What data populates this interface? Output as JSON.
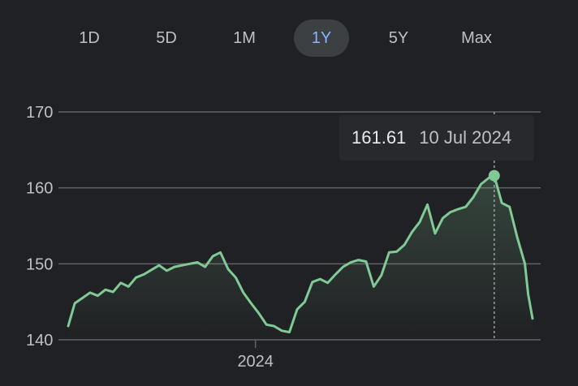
{
  "range_tabs": {
    "items": [
      {
        "label": "1D"
      },
      {
        "label": "5D"
      },
      {
        "label": "1M"
      },
      {
        "label": "1Y"
      },
      {
        "label": "5Y"
      },
      {
        "label": "Max"
      }
    ],
    "active": "1Y"
  },
  "tooltip": {
    "value": "161.61",
    "date": "10 Jul 2024"
  },
  "colors": {
    "background": "#202124",
    "line": "#81c995",
    "grid": "#5f6368",
    "tab_active_bg": "#3c4043",
    "tab_active_text": "#8ab4f8",
    "text": "#bdc1c6"
  },
  "chart_data": {
    "type": "area",
    "title": "",
    "xlabel": "",
    "ylabel": "",
    "ylim": [
      140,
      170
    ],
    "y_ticks": [
      140,
      150,
      160,
      170
    ],
    "x_ticks": [
      {
        "label": "2024",
        "x": "2024-01-01"
      }
    ],
    "grid": true,
    "series": [
      {
        "points": [
          [
            "2023-07-14",
            141.8
          ],
          [
            "2023-07-20",
            144.8
          ],
          [
            "2023-07-27",
            145.5
          ],
          [
            "2023-08-03",
            146.2
          ],
          [
            "2023-08-10",
            145.8
          ],
          [
            "2023-08-17",
            146.6
          ],
          [
            "2023-08-24",
            146.3
          ],
          [
            "2023-08-31",
            147.5
          ],
          [
            "2023-09-07",
            147.0
          ],
          [
            "2023-09-14",
            148.2
          ],
          [
            "2023-09-21",
            148.6
          ],
          [
            "2023-09-28",
            149.2
          ],
          [
            "2023-10-05",
            149.8
          ],
          [
            "2023-10-12",
            149.1
          ],
          [
            "2023-10-19",
            149.6
          ],
          [
            "2023-10-26",
            149.8
          ],
          [
            "2023-11-02",
            150.0
          ],
          [
            "2023-11-09",
            150.2
          ],
          [
            "2023-11-16",
            149.6
          ],
          [
            "2023-11-23",
            151.0
          ],
          [
            "2023-11-30",
            151.5
          ],
          [
            "2023-12-07",
            149.3
          ],
          [
            "2023-12-14",
            148.2
          ],
          [
            "2023-12-21",
            146.2
          ],
          [
            "2023-12-28",
            144.8
          ],
          [
            "2024-01-04",
            143.5
          ],
          [
            "2024-01-11",
            142.0
          ],
          [
            "2024-01-18",
            141.8
          ],
          [
            "2024-01-25",
            141.2
          ],
          [
            "2024-02-01",
            141.0
          ],
          [
            "2024-02-08",
            144.0
          ],
          [
            "2024-02-15",
            145.0
          ],
          [
            "2024-02-22",
            147.6
          ],
          [
            "2024-02-29",
            148.0
          ],
          [
            "2024-03-07",
            147.5
          ],
          [
            "2024-03-14",
            148.6
          ],
          [
            "2024-03-21",
            149.6
          ],
          [
            "2024-03-28",
            150.2
          ],
          [
            "2024-04-04",
            150.5
          ],
          [
            "2024-04-11",
            150.3
          ],
          [
            "2024-04-18",
            147.0
          ],
          [
            "2024-04-25",
            148.5
          ],
          [
            "2024-05-02",
            151.5
          ],
          [
            "2024-05-09",
            151.6
          ],
          [
            "2024-05-16",
            152.5
          ],
          [
            "2024-05-23",
            154.2
          ],
          [
            "2024-05-30",
            155.5
          ],
          [
            "2024-06-06",
            157.8
          ],
          [
            "2024-06-13",
            154.0
          ],
          [
            "2024-06-20",
            156.0
          ],
          [
            "2024-06-27",
            156.8
          ],
          [
            "2024-07-04",
            157.2
          ],
          [
            "2024-07-11",
            157.5
          ],
          [
            "2024-07-18",
            158.8
          ],
          [
            "2024-07-25",
            160.5
          ],
          [
            "2024-08-01",
            161.3
          ],
          [
            "2024-08-06",
            161.61
          ],
          [
            "2024-08-13",
            158.0
          ],
          [
            "2024-08-20",
            157.5
          ],
          [
            "2024-08-27",
            153.5
          ],
          [
            "2024-09-03",
            150.0
          ],
          [
            "2024-09-06",
            146.0
          ],
          [
            "2024-09-10",
            142.8
          ]
        ]
      }
    ],
    "highlight": {
      "x": "2024-08-06",
      "y": 161.61
    }
  }
}
